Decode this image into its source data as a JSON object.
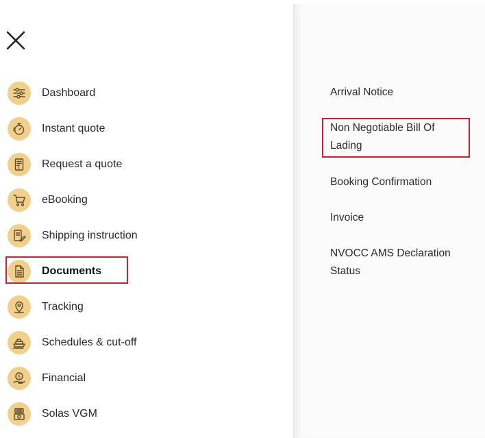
{
  "menu": {
    "items": [
      {
        "label": "Dashboard",
        "icon": "sliders-icon"
      },
      {
        "label": "Instant quote",
        "icon": "stopwatch-icon"
      },
      {
        "label": "Request a quote",
        "icon": "receipt-icon"
      },
      {
        "label": "eBooking",
        "icon": "cart-icon"
      },
      {
        "label": "Shipping instruction",
        "icon": "edit-document-icon"
      },
      {
        "label": "Documents",
        "icon": "document-icon",
        "active": true
      },
      {
        "label": "Tracking",
        "icon": "map-pin-icon"
      },
      {
        "label": "Schedules & cut-off",
        "icon": "ship-icon"
      },
      {
        "label": "Financial",
        "icon": "coin-hand-icon"
      },
      {
        "label": "Solas VGM",
        "icon": "scale-weight-icon"
      }
    ]
  },
  "documents": {
    "items": [
      {
        "label": "Arrival Notice"
      },
      {
        "label": "Non Negotiable Bill Of Lading",
        "highlighted": true
      },
      {
        "label": "Booking Confirmation"
      },
      {
        "label": "Invoice"
      },
      {
        "label": "NVOCC AMS Declaration Status"
      }
    ]
  },
  "colors": {
    "icon_bg": "#f0d08a",
    "icon_stroke": "#5a4a28",
    "highlight": "#d3202f"
  }
}
